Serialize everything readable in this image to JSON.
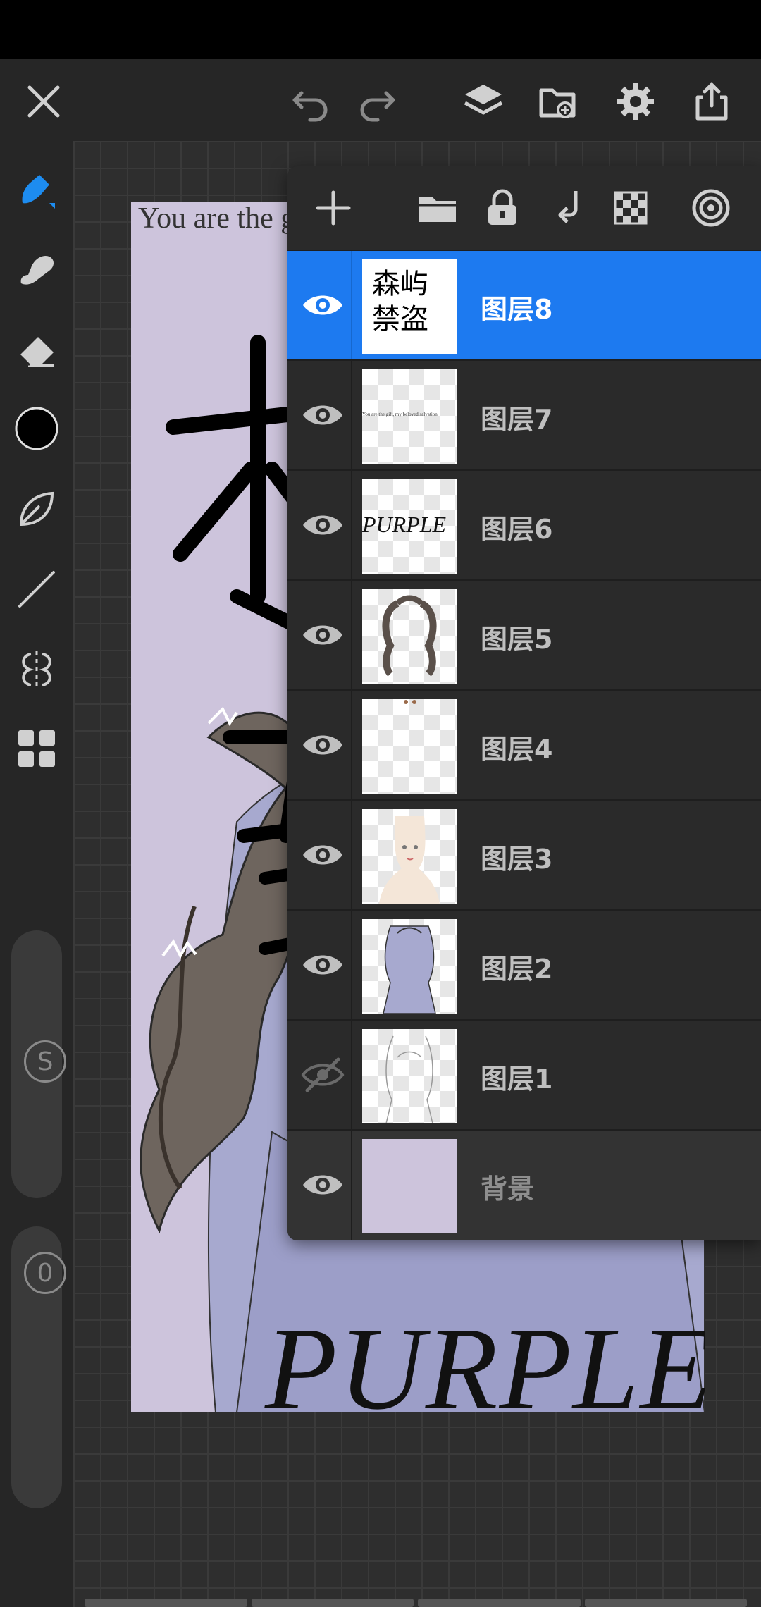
{
  "artwork": {
    "top_text": "You are the gift my heart is to have",
    "bottom_text": "PURPLE",
    "background_color": "#cdc4dc"
  },
  "topbar": {
    "icons": [
      "close-icon",
      "undo-icon",
      "redo-icon",
      "layers-icon",
      "gallery-import-icon",
      "settings-icon",
      "share-icon"
    ]
  },
  "sidebar": {
    "tools": [
      "brush-icon",
      "smudge-icon",
      "eraser-icon",
      "color-swatch",
      "leaf-stroke-icon",
      "line-icon",
      "symmetry-icon",
      "grid-layout-icon"
    ],
    "brush_size_label": "S",
    "opacity_label": "0",
    "current_color": "#000000"
  },
  "layers_panel": {
    "header_icons": [
      "add-layer-icon",
      "folder-icon",
      "lock-icon",
      "merge-down-icon",
      "checkerboard-icon",
      "target-icon"
    ],
    "layers": [
      {
        "name": "图层8",
        "visible": true,
        "selected": true,
        "thumb_text": "森屿\n禁盗"
      },
      {
        "name": "图层7",
        "visible": true,
        "selected": false,
        "thumb_text": "You are the gift, my beloved salvation"
      },
      {
        "name": "图层6",
        "visible": true,
        "selected": false,
        "thumb_text": "PURPLE"
      },
      {
        "name": "图层5",
        "visible": true,
        "selected": false,
        "thumb_text": ""
      },
      {
        "name": "图层4",
        "visible": true,
        "selected": false,
        "thumb_text": ""
      },
      {
        "name": "图层3",
        "visible": true,
        "selected": false,
        "thumb_text": ""
      },
      {
        "name": "图层2",
        "visible": true,
        "selected": false,
        "thumb_text": ""
      },
      {
        "name": "图层1",
        "visible": false,
        "selected": false,
        "thumb_text": ""
      },
      {
        "name": "背景",
        "visible": true,
        "selected": false,
        "thumb_text": ""
      }
    ]
  },
  "colors": {
    "accent": "#1d7af0",
    "panel": "#2a2a2a",
    "icon": "#d0d0d0"
  }
}
